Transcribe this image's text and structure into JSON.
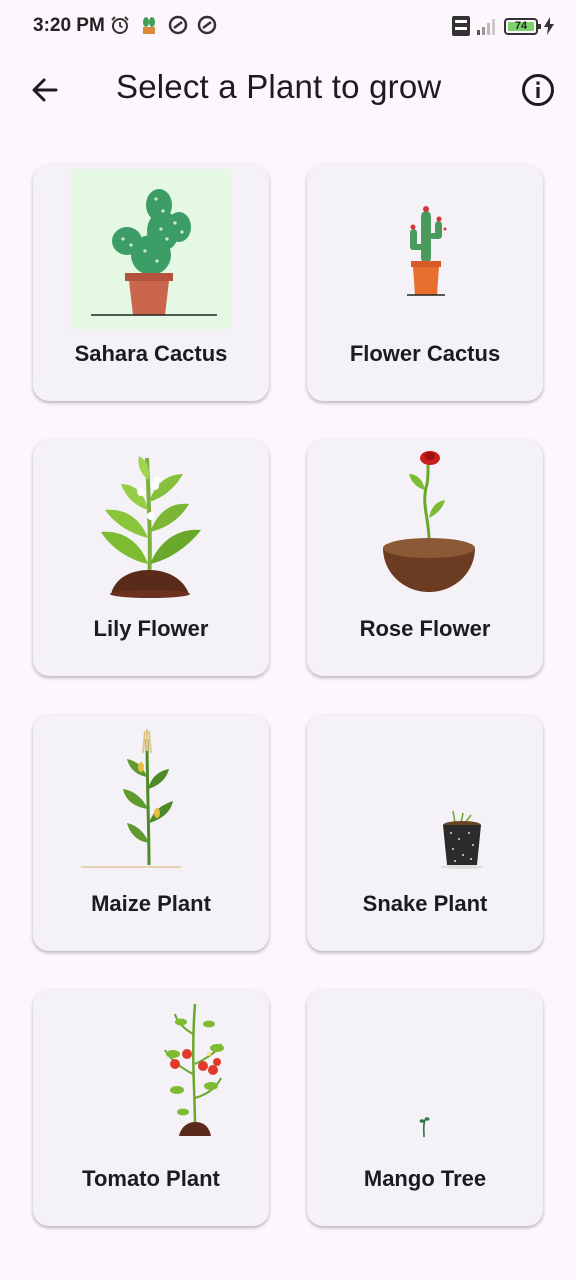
{
  "status_bar": {
    "time": "3:20 PM",
    "battery": "74",
    "left_icons": [
      "alarm-icon",
      "plant-notification-icon",
      "app-notification-icon",
      "app-notification-icon"
    ],
    "right_icons": [
      "volte-icon",
      "signal-icon",
      "battery-icon",
      "charging-icon"
    ]
  },
  "app_bar": {
    "title": "Select a Plant to grow",
    "back_icon": "arrow-left-icon",
    "info_icon": "info-icon"
  },
  "plants": [
    {
      "label": "Sahara Cactus",
      "icon": "sahara-cactus-illustration"
    },
    {
      "label": "Flower Cactus",
      "icon": "flower-cactus-illustration"
    },
    {
      "label": "Lily Flower",
      "icon": "lily-flower-illustration"
    },
    {
      "label": "Rose Flower",
      "icon": "rose-flower-illustration"
    },
    {
      "label": "Maize Plant",
      "icon": "maize-plant-illustration"
    },
    {
      "label": "Snake Plant",
      "icon": "snake-plant-illustration"
    },
    {
      "label": "Tomato Plant",
      "icon": "tomato-plant-illustration"
    },
    {
      "label": "Mango Tree",
      "icon": "mango-sprout-illustration"
    }
  ],
  "colors": {
    "background": "#fdf7fd",
    "card": "#f4f2f6",
    "text": "#1d1b20"
  }
}
